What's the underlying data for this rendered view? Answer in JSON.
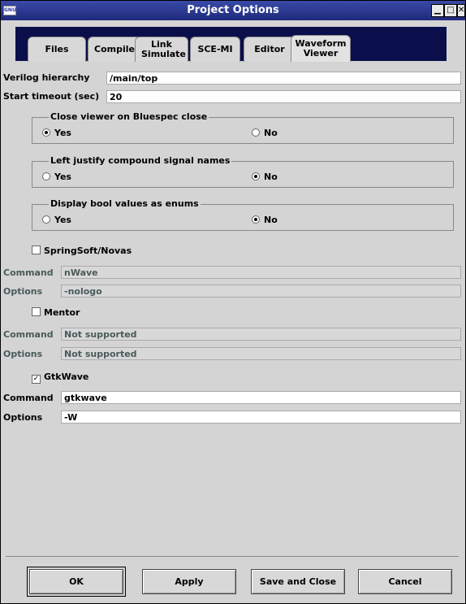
{
  "window": {
    "title": "Project Options",
    "sys_icon": "GNU"
  },
  "tabs": [
    {
      "label": "Files"
    },
    {
      "label": "Compile"
    },
    {
      "label": "Link Simulate"
    },
    {
      "label": "SCE-MI"
    },
    {
      "label": "Editor"
    },
    {
      "label": "Waveform Viewer",
      "active": true
    }
  ],
  "fields": {
    "verilog_hierarchy": {
      "label": "Verilog hierarchy",
      "value": "/main/top"
    },
    "start_timeout": {
      "label": "Start timeout (sec)",
      "value": "20"
    }
  },
  "groups": [
    {
      "title": "Close viewer on Bluespec close",
      "yes": "Yes",
      "no": "No",
      "selected": "Yes"
    },
    {
      "title": "Left justify compound signal names",
      "yes": "Yes",
      "no": "No",
      "selected": "No"
    },
    {
      "title": "Display bool values as enums",
      "yes": "Yes",
      "no": "No",
      "selected": "No"
    }
  ],
  "viewers": [
    {
      "name": "SpringSoft/Novas",
      "checked": false,
      "command_label": "Command",
      "command": "nWave",
      "options_label": "Options",
      "options": "-nologo"
    },
    {
      "name": "Mentor",
      "checked": false,
      "command_label": "Command",
      "command": "Not supported",
      "options_label": "Options",
      "options": "Not supported"
    },
    {
      "name": "GtkWave",
      "checked": true,
      "command_label": "Command",
      "command": "gtkwave",
      "options_label": "Options",
      "options": "-W"
    }
  ],
  "buttons": {
    "ok": "OK",
    "apply": "Apply",
    "save_close": "Save and Close",
    "cancel": "Cancel"
  },
  "colors": {
    "title_bar": "#1e2a7a",
    "tab_strip": "#0a0e4a",
    "disabled_text": "#4a5a5a"
  },
  "icons": {
    "checked": "✓",
    "minimize": "▁",
    "maximize": "□",
    "close": "✕"
  }
}
